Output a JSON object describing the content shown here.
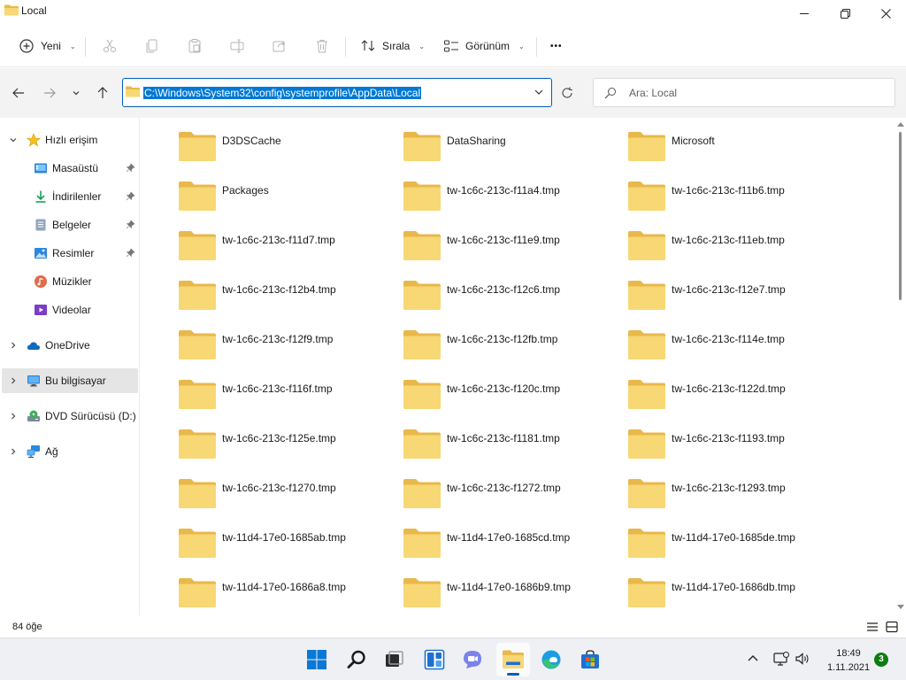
{
  "window": {
    "title": "Local",
    "minimize_icon": "minimize-icon",
    "maximize_icon": "restore-icon",
    "close_icon": "close-icon"
  },
  "command_bar": {
    "new_label": "Yeni",
    "sort_label": "Sırala",
    "view_label": "Görünüm",
    "more_label": "•••"
  },
  "address_bar": {
    "path": "C:\\Windows\\System32\\config\\systemprofile\\AppData\\Local",
    "search_placeholder": "Ara: Local"
  },
  "sidebar": {
    "items": [
      {
        "label": "Hızlı erişim",
        "icon": "star-icon"
      },
      {
        "label": "Masaüstü",
        "icon": "desktop-icon"
      },
      {
        "label": "İndirilenler",
        "icon": "download-icon"
      },
      {
        "label": "Belgeler",
        "icon": "documents-icon"
      },
      {
        "label": "Resimler",
        "icon": "pictures-icon"
      },
      {
        "label": "Müzikler",
        "icon": "music-icon"
      },
      {
        "label": "Videolar",
        "icon": "videos-icon"
      },
      {
        "label": "OneDrive",
        "icon": "cloud-icon"
      },
      {
        "label": "Bu bilgisayar",
        "icon": "computer-icon"
      },
      {
        "label": "DVD Sürücüsü (D:) C",
        "icon": "dvd-icon"
      },
      {
        "label": "Ağ",
        "icon": "network-icon"
      }
    ]
  },
  "files": [
    "D3DSCache",
    "DataSharing",
    "Microsoft",
    "Packages",
    "tw-1c6c-213c-f11a4.tmp",
    "tw-1c6c-213c-f11b6.tmp",
    "tw-1c6c-213c-f11d7.tmp",
    "tw-1c6c-213c-f11e9.tmp",
    "tw-1c6c-213c-f11eb.tmp",
    "tw-1c6c-213c-f12b4.tmp",
    "tw-1c6c-213c-f12c6.tmp",
    "tw-1c6c-213c-f12e7.tmp",
    "tw-1c6c-213c-f12f9.tmp",
    "tw-1c6c-213c-f12fb.tmp",
    "tw-1c6c-213c-f114e.tmp",
    "tw-1c6c-213c-f116f.tmp",
    "tw-1c6c-213c-f120c.tmp",
    "tw-1c6c-213c-f122d.tmp",
    "tw-1c6c-213c-f125e.tmp",
    "tw-1c6c-213c-f1181.tmp",
    "tw-1c6c-213c-f1193.tmp",
    "tw-1c6c-213c-f1270.tmp",
    "tw-1c6c-213c-f1272.tmp",
    "tw-1c6c-213c-f1293.tmp",
    "tw-11d4-17e0-1685ab.tmp",
    "tw-11d4-17e0-1685cd.tmp",
    "tw-11d4-17e0-1685de.tmp",
    "tw-11d4-17e0-1686a8.tmp",
    "tw-11d4-17e0-1686b9.tmp",
    "tw-11d4-17e0-1686db.tmp"
  ],
  "status": {
    "item_count": "84 öğe"
  },
  "taskbar": {
    "apps": [
      "windows-start-icon",
      "search-icon",
      "task-view-icon",
      "widgets-icon",
      "teams-chat-icon",
      "file-explorer-icon",
      "edge-icon",
      "store-icon"
    ],
    "time": "18:49",
    "date": "1.11.2021",
    "notification_count": "3"
  },
  "colors": {
    "accent": "#005fb8",
    "folder": "#f8d775",
    "folder_dark": "#e8b84a"
  }
}
